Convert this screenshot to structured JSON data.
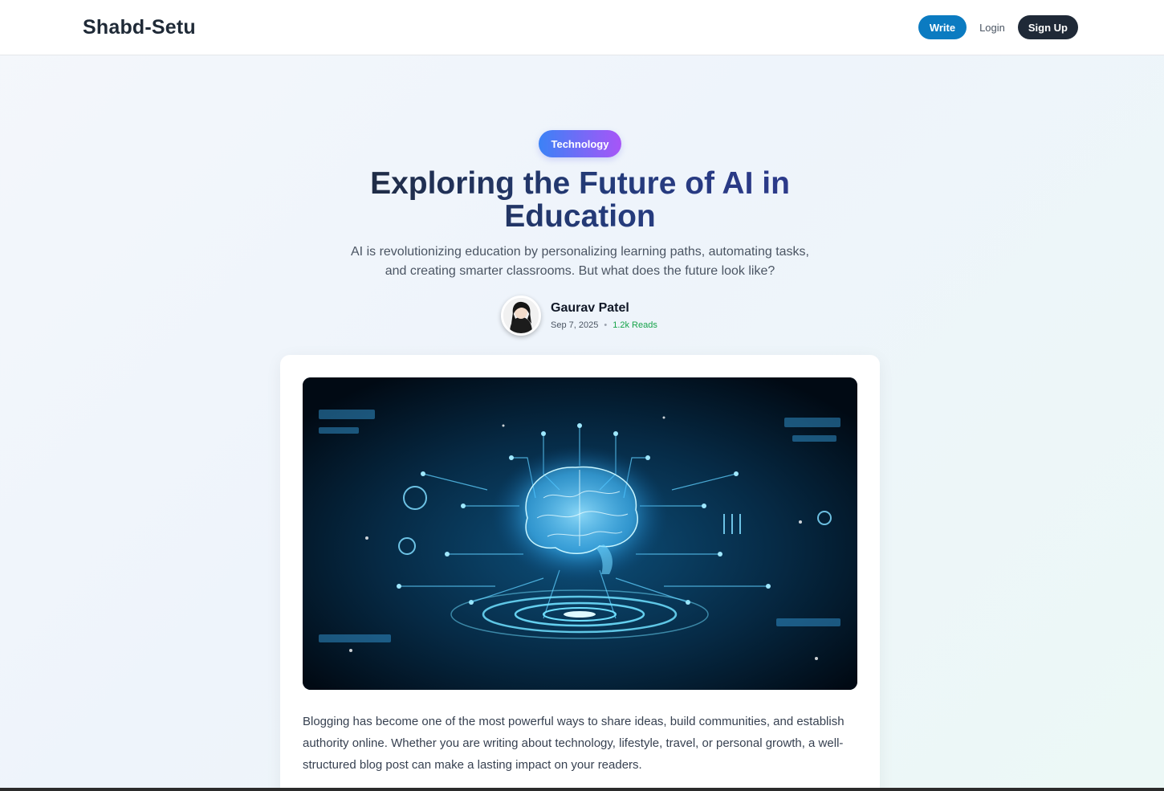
{
  "header": {
    "brand": "Shabd-Setu",
    "write_label": "Write",
    "login_label": "Login",
    "signup_label": "Sign Up"
  },
  "post": {
    "category": "Technology",
    "title": "Exploring the Future of AI in Education",
    "subtitle": "AI is revolutionizing education by personalizing learning paths, automating tasks, and creating smarter classrooms. But what does the future look like?",
    "author": {
      "name": "Gaurav Patel",
      "date": "Sep 7, 2025",
      "separator": "•",
      "reads": "1.2k Reads"
    },
    "image_icon": "ai-brain-circuit-image",
    "body": "Blogging has become one of the most powerful ways to share ideas, build communities, and establish authority online. Whether you are writing about technology, lifestyle, travel, or personal growth, a well-structured blog post can make a lasting impact on your readers."
  },
  "colors": {
    "write_button": "#0b7bc1",
    "signup_button": "#1f2937",
    "tag_gradient_start": "#3b82f6",
    "tag_gradient_end": "#a855f7",
    "reads_accent": "#16a34a"
  }
}
